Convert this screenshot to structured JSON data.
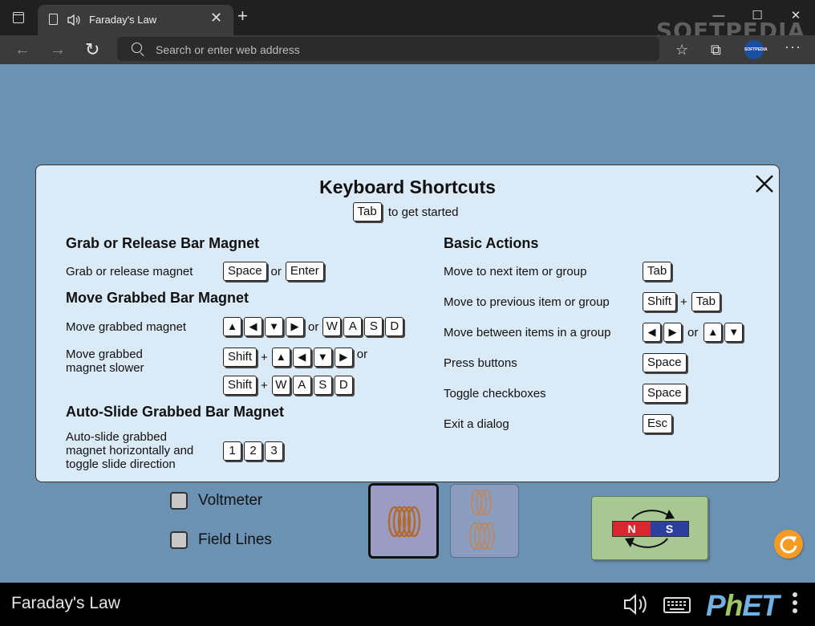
{
  "browser": {
    "tab_title": "Faraday's Law",
    "tab_close": "✕",
    "new_tab": "+",
    "minimize": "—",
    "maximize": "☐",
    "close": "✕",
    "address_placeholder": "Search or enter web address",
    "watermark": "SOFTPEDIA",
    "profile_text": "SOFTPEDIA"
  },
  "dialog": {
    "title": "Keyboard Shortcuts",
    "intro_key": "Tab",
    "intro_text": "to get started",
    "left": {
      "grab_heading": "Grab or Release Bar Magnet",
      "grab_label": "Grab or release magnet",
      "grab_keys": [
        "Space",
        "Enter"
      ],
      "move_heading": "Move Grabbed Bar Magnet",
      "move_label": "Move grabbed magnet",
      "move_slow_label": "Move grabbed magnet slower",
      "arrows": [
        "▲",
        "◀",
        "▼",
        "▶"
      ],
      "wasd": [
        "W",
        "A",
        "S",
        "D"
      ],
      "shift": "Shift",
      "or": "or",
      "plus": "+",
      "auto_heading": "Auto-Slide Grabbed Bar Magnet",
      "auto_label": "Auto-slide grabbed magnet horizontally and toggle slide direction",
      "auto_keys": [
        "1",
        "2",
        "3"
      ]
    },
    "right": {
      "heading": "Basic Actions",
      "next_label": "Move to next item or group",
      "next_key": "Tab",
      "prev_label": "Move to previous item or group",
      "prev_keys": [
        "Shift",
        "Tab"
      ],
      "between_label": "Move between items in a group",
      "lr_arrows": [
        "◀",
        "▶"
      ],
      "ud_arrows": [
        "▲",
        "▼"
      ],
      "press_label": "Press buttons",
      "press_key": "Space",
      "toggle_label": "Toggle checkboxes",
      "toggle_key": "Space",
      "exit_label": "Exit a dialog",
      "exit_key": "Esc"
    }
  },
  "sim": {
    "voltmeter_label": "Voltmeter",
    "field_lines_label": "Field Lines",
    "magnet_n": "N",
    "magnet_s": "S"
  },
  "footer": {
    "title": "Faraday's Law",
    "logo_p": "P",
    "logo_h": "h",
    "logo_et": "ET"
  },
  "colors": {
    "sim_background": "#6b91b3",
    "dialog_background": "#daeaf6",
    "magnet_north": "#d9262f",
    "magnet_south": "#2b3f9e",
    "reset_orange": "#f59a23"
  }
}
